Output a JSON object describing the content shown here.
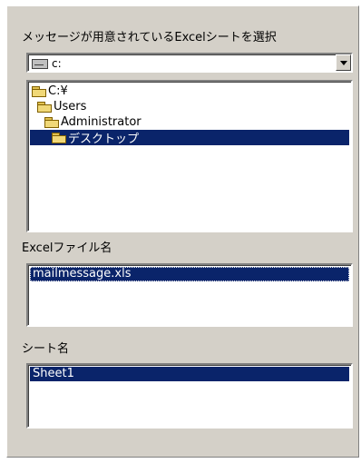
{
  "header": {
    "label": "メッセージが用意されているExcelシートを選択"
  },
  "drive_combo": {
    "value": "c:",
    "icon": "drive-icon"
  },
  "folder_tree": {
    "items": [
      {
        "label": "C:¥",
        "depth": 0,
        "selected": false
      },
      {
        "label": "Users",
        "depth": 1,
        "selected": false
      },
      {
        "label": "Administrator",
        "depth": 2,
        "selected": false
      },
      {
        "label": "デスクトップ",
        "depth": 3,
        "selected": true
      }
    ]
  },
  "file_section": {
    "label": "Excelファイル名",
    "items": [
      {
        "label": "mailmessage.xls",
        "selected": true
      }
    ]
  },
  "sheet_section": {
    "label": "シート名",
    "items": [
      {
        "label": "Sheet1",
        "selected": true
      }
    ]
  },
  "colors": {
    "panel": "#d4d0c8",
    "selection": "#0a246a"
  }
}
